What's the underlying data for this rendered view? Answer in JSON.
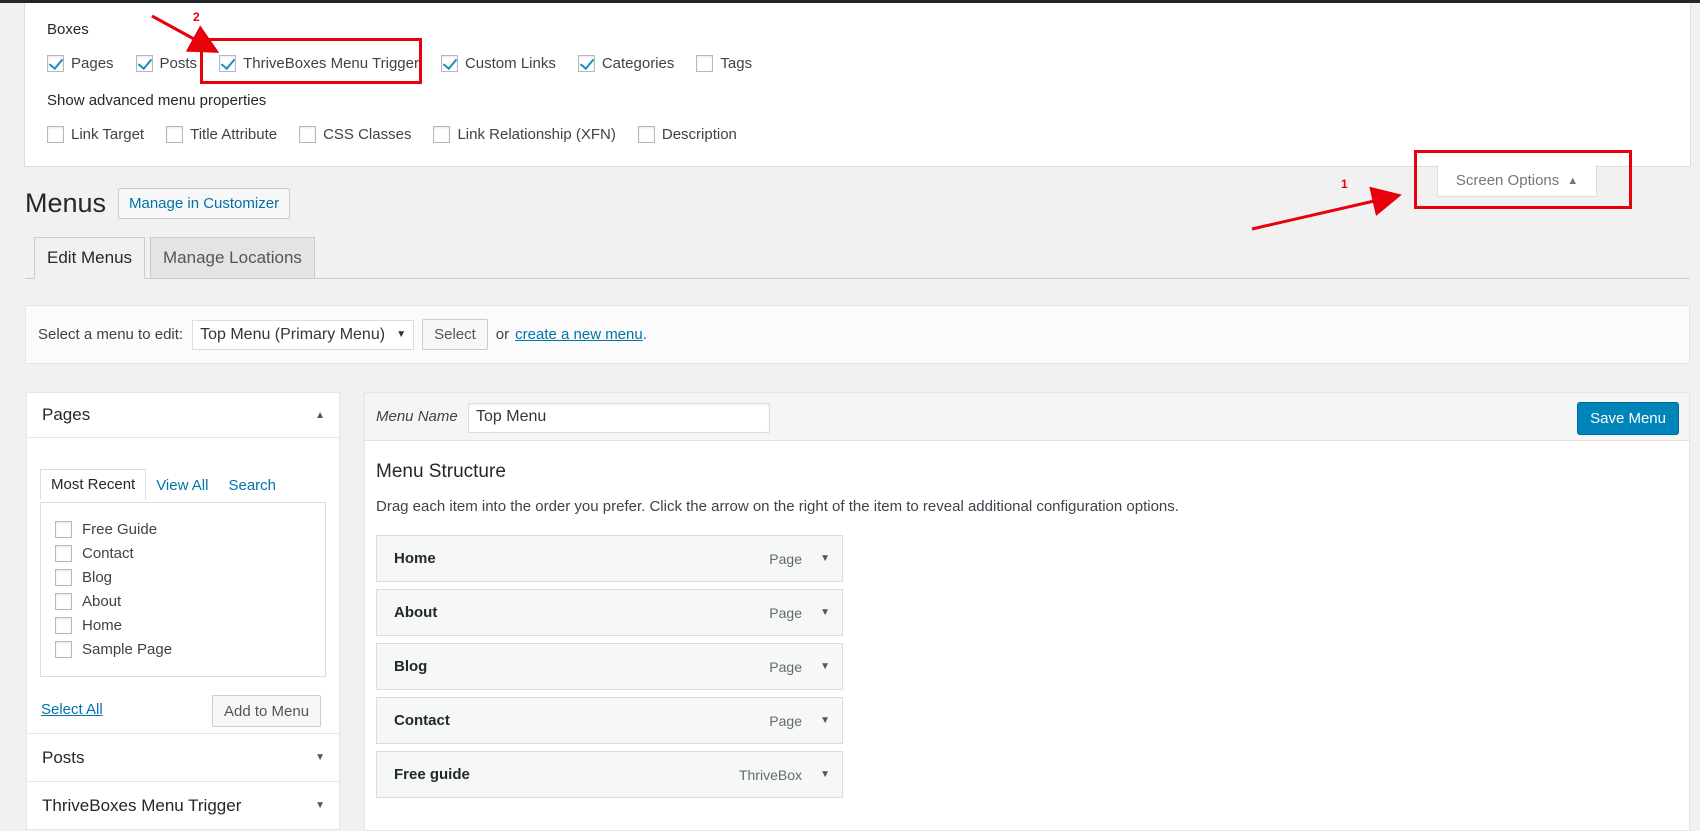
{
  "screen_options": {
    "boxes_heading": "Boxes",
    "boxes": [
      {
        "label": "Pages",
        "checked": true
      },
      {
        "label": "Posts",
        "checked": true
      },
      {
        "label": "ThriveBoxes Menu Trigger",
        "checked": true
      },
      {
        "label": "Custom Links",
        "checked": true
      },
      {
        "label": "Categories",
        "checked": true
      },
      {
        "label": "Tags",
        "checked": false
      }
    ],
    "advanced_heading": "Show advanced menu properties",
    "advanced": [
      {
        "label": "Link Target",
        "checked": false
      },
      {
        "label": "Title Attribute",
        "checked": false
      },
      {
        "label": "CSS Classes",
        "checked": false
      },
      {
        "label": "Link Relationship (XFN)",
        "checked": false
      },
      {
        "label": "Description",
        "checked": false
      }
    ],
    "tab_label": "Screen Options"
  },
  "annotations": {
    "step1": "1",
    "step2": "2",
    "color": "#e8000b"
  },
  "header": {
    "title": "Menus",
    "customizer_button": "Manage in Customizer"
  },
  "tabs": [
    {
      "label": "Edit Menus",
      "active": true
    },
    {
      "label": "Manage Locations",
      "active": false
    }
  ],
  "select_bar": {
    "label": "Select a menu to edit:",
    "selected_menu": "Top Menu (Primary Menu)",
    "select_button": "Select",
    "or_text": "or",
    "create_link": "create a new menu",
    "period": "."
  },
  "pages_box": {
    "title": "Pages",
    "tabs": [
      "Most Recent",
      "View All",
      "Search"
    ],
    "items": [
      "Free Guide",
      "Contact",
      "Blog",
      "About",
      "Home",
      "Sample Page"
    ],
    "select_all": "Select All",
    "add_button": "Add to Menu"
  },
  "collapsed_boxes": [
    "Posts",
    "ThriveBoxes Menu Trigger"
  ],
  "editor": {
    "menu_name_label": "Menu Name",
    "menu_name_value": "Top Menu",
    "save_button": "Save Menu",
    "structure_title": "Menu Structure",
    "structure_desc": "Drag each item into the order you prefer. Click the arrow on the right of the item to reveal additional configuration options.",
    "items": [
      {
        "title": "Home",
        "type": "Page"
      },
      {
        "title": "About",
        "type": "Page"
      },
      {
        "title": "Blog",
        "type": "Page"
      },
      {
        "title": "Contact",
        "type": "Page"
      },
      {
        "title": "Free guide",
        "type": "ThriveBox"
      }
    ]
  },
  "colors": {
    "accent": "#0073aa",
    "save_button": "#0085ba",
    "checkmark": "#1e8cbe"
  }
}
